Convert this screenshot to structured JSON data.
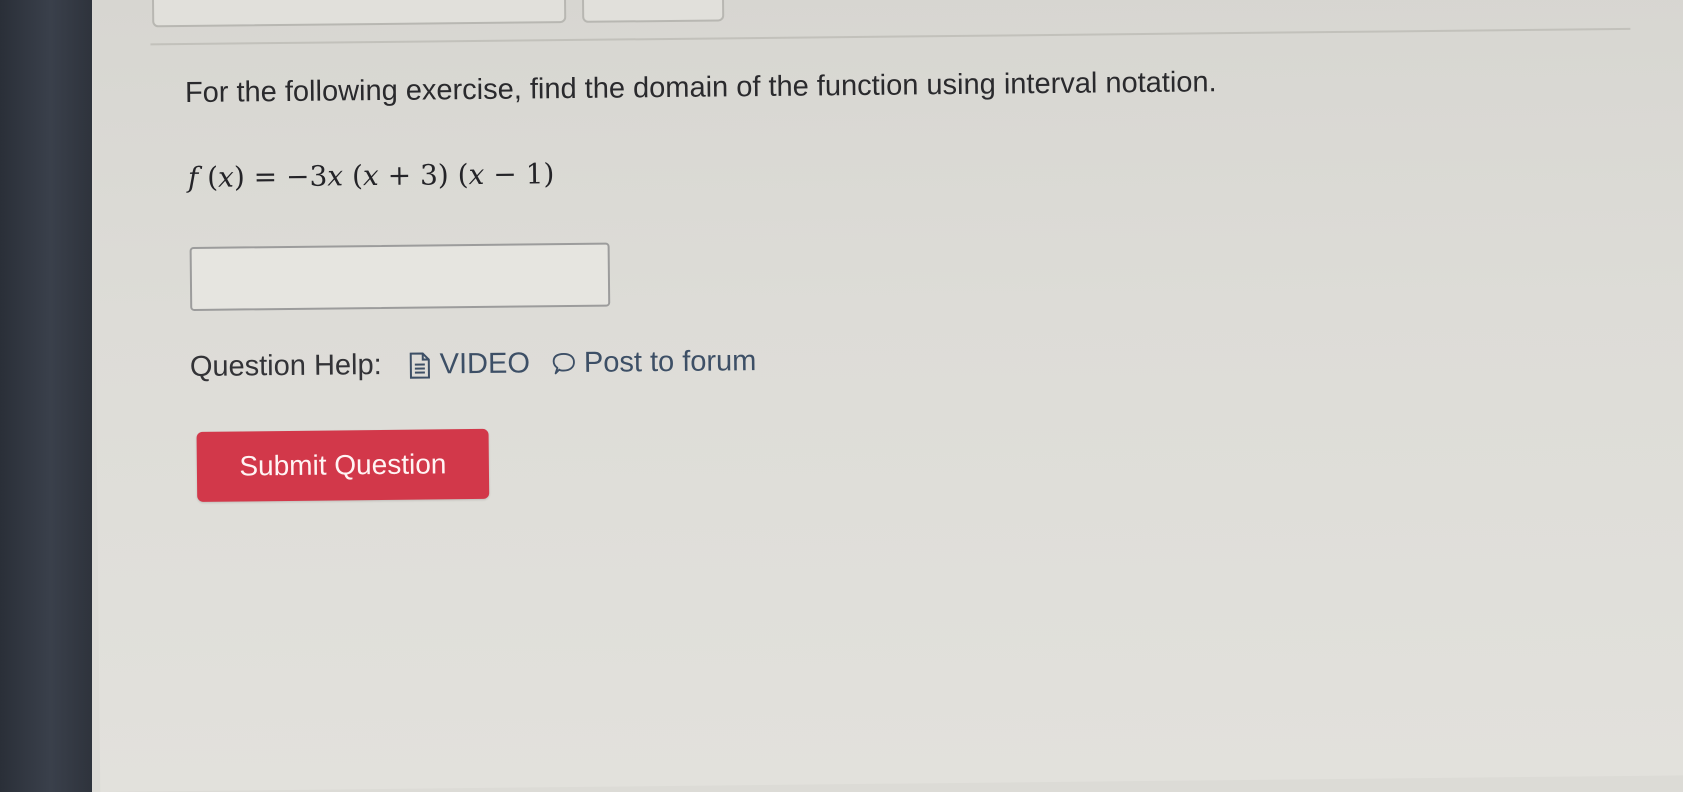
{
  "question": {
    "prompt": "For the following exercise, find the domain of the function using interval notation.",
    "formula": {
      "f": "f",
      "lparen1": " (",
      "x1": "x",
      "rparen1": ") = −3",
      "x2": "x",
      "lparen2": " (",
      "x3": "x",
      "plus": " + 3) (",
      "x4": "x",
      "minus": " − 1)"
    }
  },
  "answer_input": {
    "value": "",
    "placeholder": ""
  },
  "help": {
    "label": "Question Help:",
    "video_label": "VIDEO",
    "video_icon": "document-icon",
    "forum_label": "Post to forum",
    "forum_icon": "speech-bubble-icon"
  },
  "submit": {
    "label": "Submit Question",
    "color": "#d2384a"
  }
}
